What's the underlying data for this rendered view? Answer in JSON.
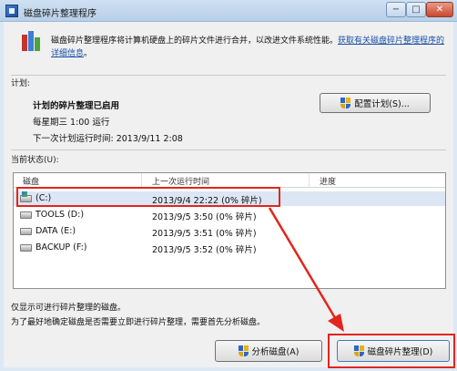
{
  "window": {
    "title": "磁盘碎片整理程序",
    "controls": {
      "minimize": "−",
      "maximize": "□",
      "close": "✕"
    }
  },
  "intro": {
    "text": "磁盘碎片整理程序将计算机硬盘上的碎片文件进行合并，以改进文件系统性能。",
    "link": "获取有关磁盘碎片整理程序的详细信息",
    "end": "。"
  },
  "schedule": {
    "section_label": "计划:",
    "status": "计划的碎片整理已启用",
    "run_time": "每星期三  1:00 运行",
    "next_run": "下一次计划运行时间: 2013/9/11 2:08",
    "configure_button": "配置计划(S)..."
  },
  "current_status": {
    "section_label": "当前状态(U):",
    "columns": [
      "磁盘",
      "上一次运行时间",
      "进度"
    ],
    "disks": [
      {
        "name": "(C:)",
        "last_run": "2013/9/4 22:22 (0% 碎片)",
        "system": true
      },
      {
        "name": "TOOLS (D:)",
        "last_run": "2013/9/5 3:50 (0% 碎片)",
        "system": false
      },
      {
        "name": "DATA (E:)",
        "last_run": "2013/9/5 3:51 (0% 碎片)",
        "system": false
      },
      {
        "name": "BACKUP (F:)",
        "last_run": "2013/9/5 3:52 (0% 碎片)",
        "system": false
      }
    ]
  },
  "notes": {
    "line1": "仅显示可进行碎片整理的磁盘。",
    "line2": "为了最好地确定磁盘是否需要立即进行碎片整理，需要首先分析磁盘。"
  },
  "buttons": {
    "analyze": "分析磁盘(A)",
    "defragment": "磁盘碎片整理(D)"
  },
  "annotation_color": "#e2251e"
}
